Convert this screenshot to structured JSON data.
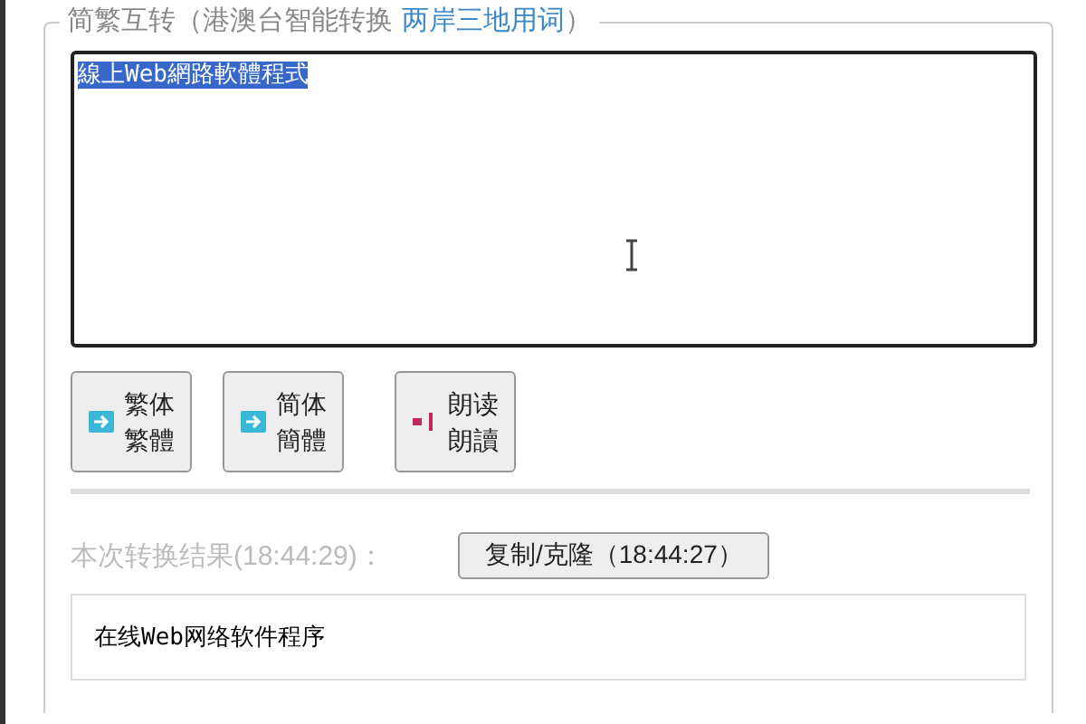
{
  "panel": {
    "legend": {
      "title": "简繁互转（港澳台智能转换",
      "link": "两岸三地用词",
      "close": "）"
    },
    "input": {
      "value": "線上Web網路軟體程式",
      "selected": true
    },
    "buttons": [
      {
        "kind": "convert",
        "lines": [
          "繁体",
          "繁體"
        ]
      },
      {
        "kind": "convert",
        "lines": [
          "简体",
          "簡體"
        ]
      },
      {
        "kind": "speak",
        "lines": [
          "朗读",
          "朗讀"
        ]
      }
    ],
    "result": {
      "label": "本次转换结果(18:44:29)：",
      "copy_button": "复制/克隆（18:44:27）",
      "text": "在线Web网络软件程序"
    }
  }
}
